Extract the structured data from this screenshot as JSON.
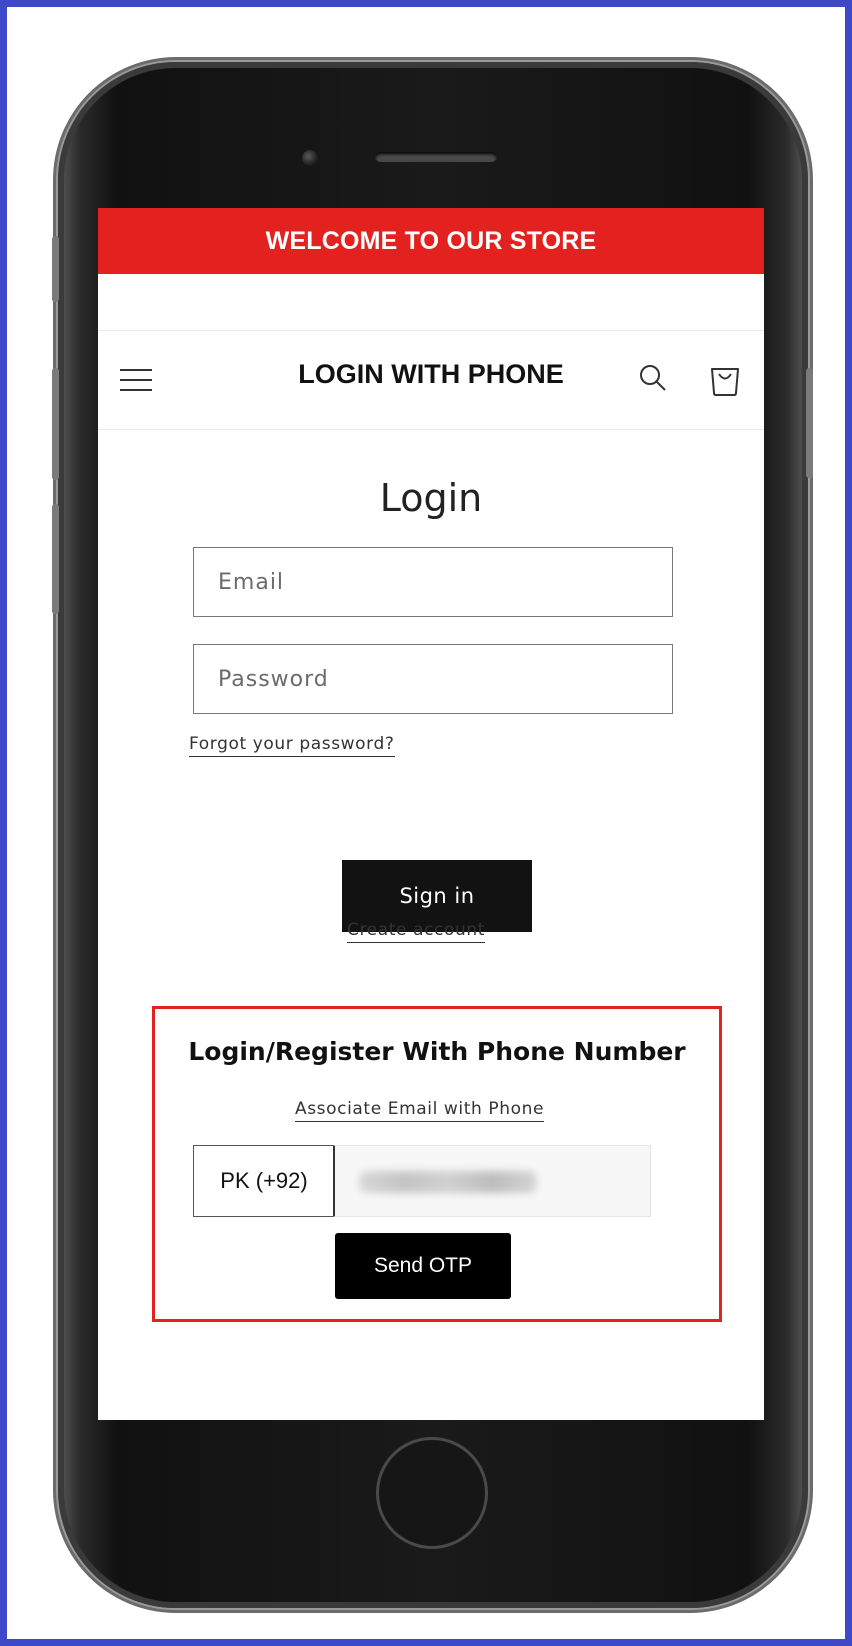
{
  "announcement": {
    "text": "WELCOME TO OUR STORE",
    "color": "#e3211f"
  },
  "header": {
    "store_title": "LOGIN WITH PHONE",
    "menu_icon": "hamburger-menu-icon",
    "search_icon": "search-icon",
    "cart_icon": "cart-icon"
  },
  "login": {
    "heading": "Login",
    "email_placeholder": "Email",
    "password_placeholder": "Password",
    "forgot_link": "Forgot your password?",
    "signin_label": "Sign in",
    "create_account_link": "Create account"
  },
  "phone_login": {
    "heading": "Login/Register With Phone Number",
    "associate_link": "Associate Email with Phone",
    "country_code": "PK (+92)",
    "send_otp_label": "Send OTP",
    "highlight_color": "#e3211f"
  },
  "frame_color": "#3d49c8"
}
